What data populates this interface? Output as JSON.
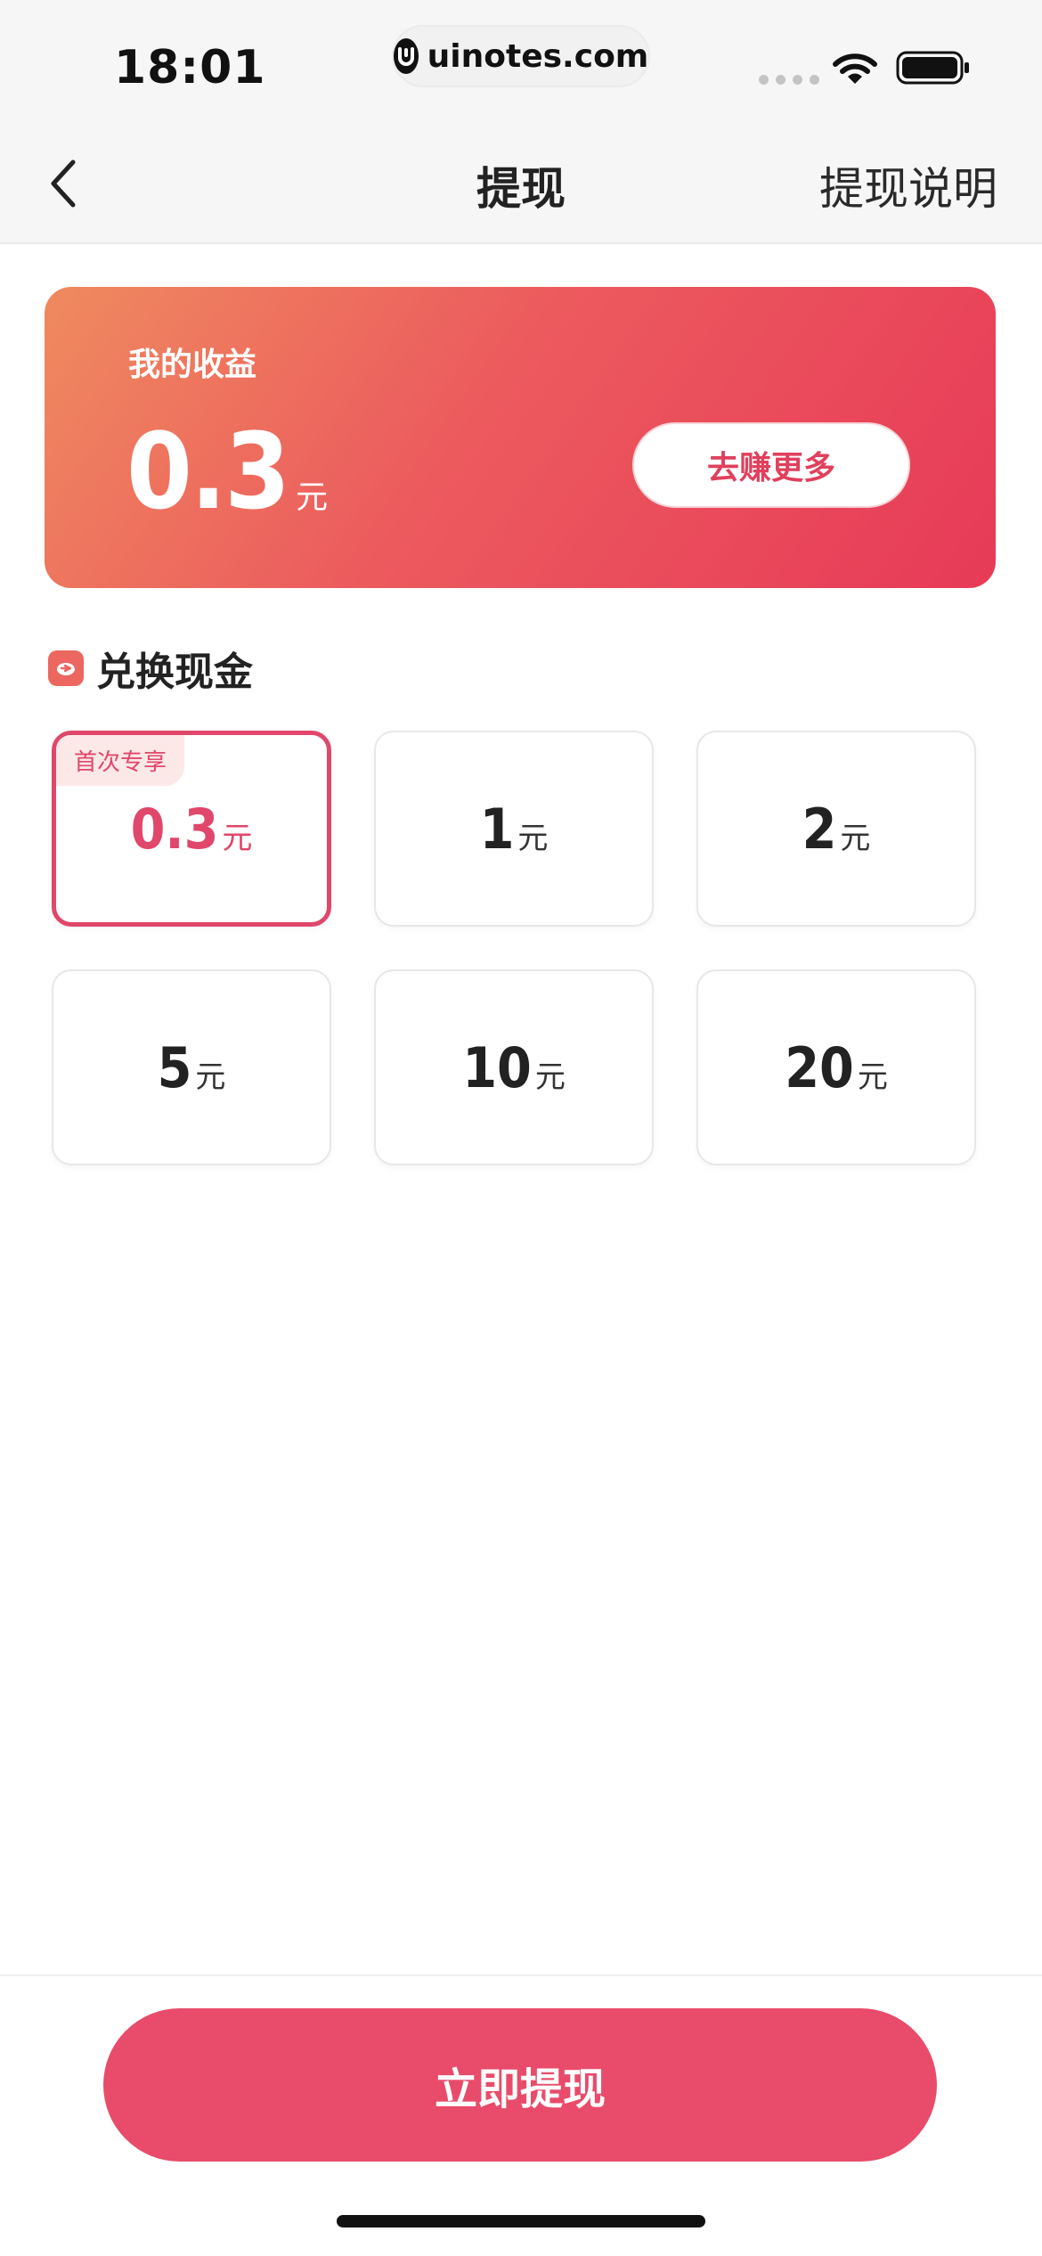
{
  "status_bar": {
    "time": "18:01",
    "url": "uinotes.com"
  },
  "nav": {
    "title": "提现",
    "right_link": "提现说明"
  },
  "earnings": {
    "label": "我的收益",
    "amount": "0.3",
    "unit": "元",
    "earn_more_label": "去赚更多"
  },
  "exchange": {
    "title": "兑换现金",
    "options": [
      {
        "value": "0.3",
        "unit": "元",
        "tag": "首次专享",
        "selected": true
      },
      {
        "value": "1",
        "unit": "元"
      },
      {
        "value": "2",
        "unit": "元"
      },
      {
        "value": "5",
        "unit": "元"
      },
      {
        "value": "10",
        "unit": "元"
      },
      {
        "value": "20",
        "unit": "元"
      }
    ]
  },
  "footer": {
    "withdraw_label": "立即提现"
  },
  "colors": {
    "accent": "#e84c6a",
    "card_start": "#ef8a5f",
    "card_end": "#e73a58"
  }
}
